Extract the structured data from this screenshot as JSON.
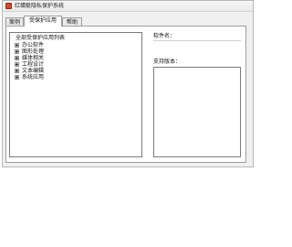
{
  "window": {
    "title": "红蜻蜓隐私保护系统"
  },
  "tabs": [
    {
      "label": "案例",
      "active": false
    },
    {
      "label": "受保护应用",
      "active": true
    },
    {
      "label": "帮助",
      "active": false
    }
  ],
  "tree": {
    "root_label": "全部受保护应用列表",
    "items": [
      {
        "label": "办公软件"
      },
      {
        "label": "图形处理"
      },
      {
        "label": "媒体相关"
      },
      {
        "label": "工程设计"
      },
      {
        "label": "文本编辑"
      },
      {
        "label": "系统应用"
      }
    ]
  },
  "details": {
    "software_name_label": "软件名：",
    "supported_versions_label": "支持版本："
  }
}
